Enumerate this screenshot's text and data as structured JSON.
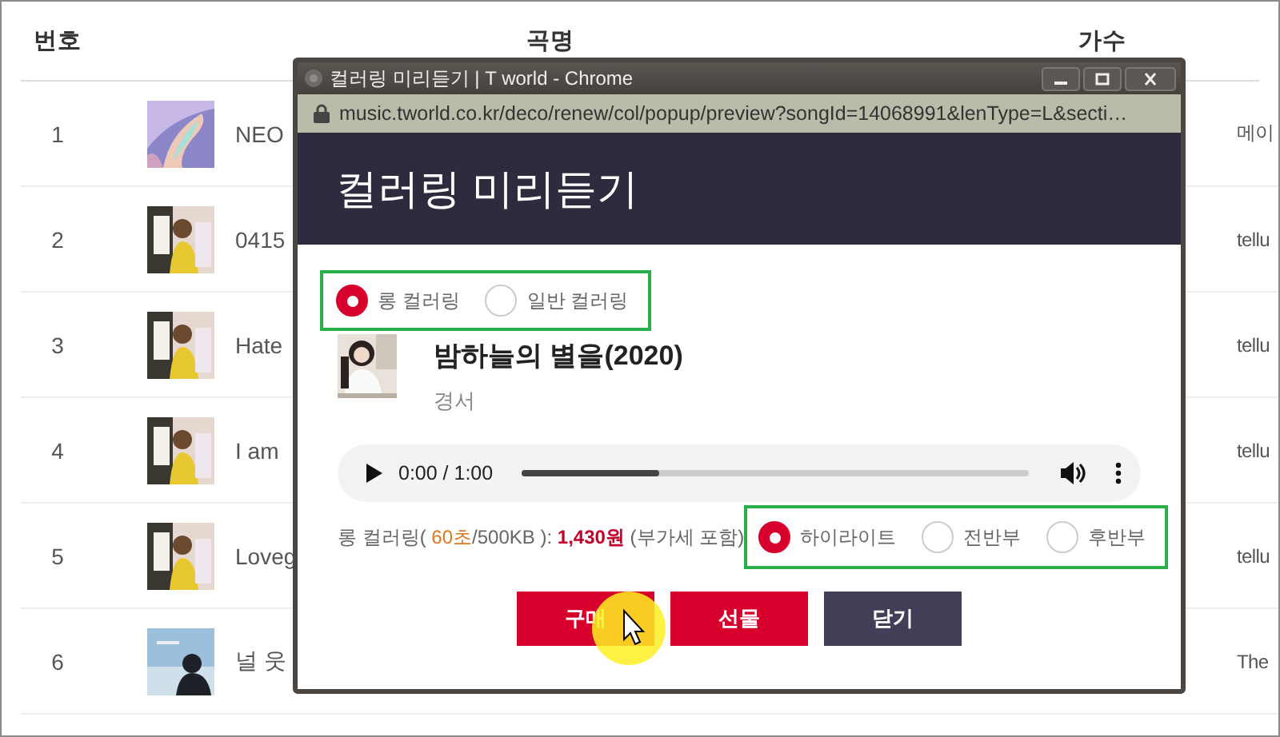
{
  "table": {
    "columns": [
      "번호",
      "곡명",
      "가수"
    ],
    "rows": [
      {
        "number": "1",
        "title": "NEO",
        "artist": "메이"
      },
      {
        "number": "2",
        "title": "0415",
        "artist": "tellu"
      },
      {
        "number": "3",
        "title": "Hate",
        "artist": "tellu"
      },
      {
        "number": "4",
        "title": "I am",
        "artist": "tellu"
      },
      {
        "number": "5",
        "title": "Loveg",
        "artist": "tellu"
      },
      {
        "number": "6",
        "title": "널 웃",
        "artist": "The"
      }
    ]
  },
  "popup": {
    "window_title": "컬러링 미리듣기 | T world - Chrome",
    "url": "music.tworld.co.kr/deco/renew/col/popup/preview?songId=14068991&lenType=L&secti…",
    "heading": "컬러링 미리듣기",
    "type_options": [
      {
        "label": "롱 컬러링",
        "selected": true
      },
      {
        "label": "일반 컬러링",
        "selected": false
      }
    ],
    "song": {
      "title": "밤하늘의 별을(2020)",
      "artist": "경서"
    },
    "player": {
      "time": "0:00 / 1:00",
      "level": 0.27
    },
    "price": [
      {
        "kind": "plain",
        "text": "롱 컬러링( "
      },
      {
        "kind": "duration",
        "text": "60초"
      },
      {
        "kind": "plain",
        "text": "/500KB ): "
      },
      {
        "kind": "price",
        "text": "1,430원"
      },
      {
        "kind": "plain",
        "text": " (부가세 포함)"
      }
    ],
    "section_options": [
      {
        "label": "하이라이트",
        "selected": true
      },
      {
        "label": "전반부",
        "selected": false
      },
      {
        "label": "후반부",
        "selected": false
      }
    ],
    "buttons": [
      {
        "label": "구매",
        "kind": "primary"
      },
      {
        "label": "선물",
        "kind": "primary"
      },
      {
        "label": "닫기",
        "kind": "secondary"
      }
    ]
  }
}
